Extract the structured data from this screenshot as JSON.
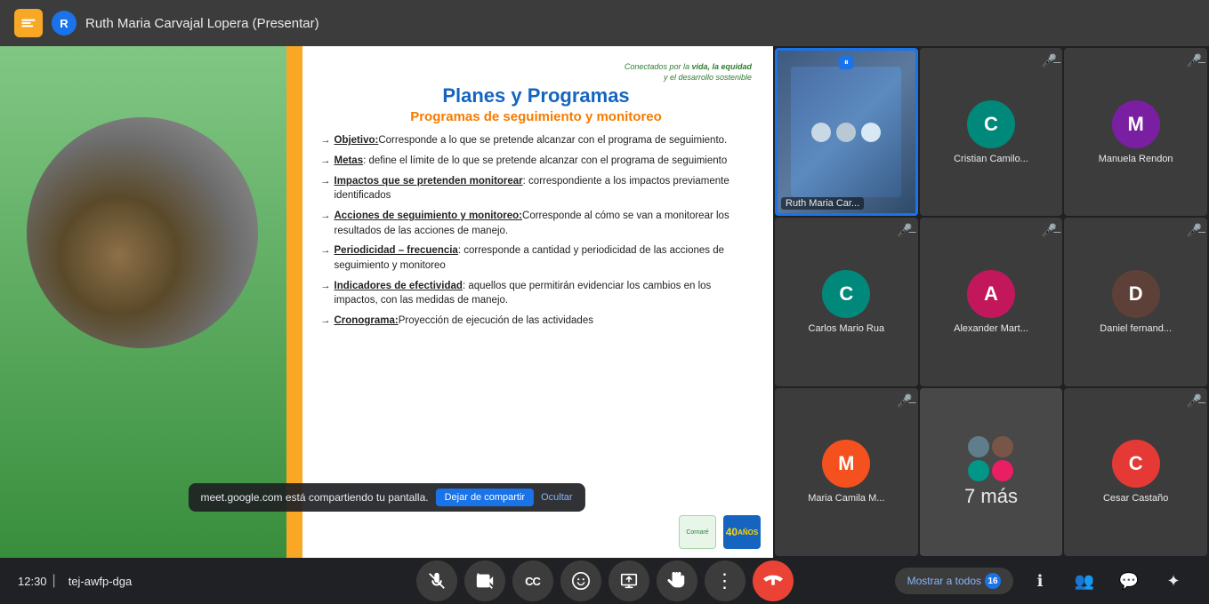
{
  "topbar": {
    "icon_label": "G",
    "avatar_letter": "R",
    "title": "Ruth Maria Carvajal Lopera (Presentar)"
  },
  "slide": {
    "top_text_line1": "Conectados por la",
    "top_text_line2": "vida, la equidad",
    "top_text_line3": "y el desarrollo sostenible",
    "title": "Planes y Programas",
    "subtitle": "Programas de seguimiento y monitoreo",
    "items": [
      {
        "arrow": "→",
        "label": "Objetivo:",
        "text": "Corresponde a lo que se pretende alcanzar con el programa de seguimiento."
      },
      {
        "arrow": "→",
        "label": "Metas",
        "text": ": define el límite de lo que se pretende alcanzar con el programa de seguimiento"
      },
      {
        "arrow": "→",
        "label": "Impactos que se pretenden monitorear",
        "text": ": correspondiente a los impactos previamente identificados"
      },
      {
        "arrow": "→",
        "label": "Acciones de seguimiento y monitoreo:",
        "text": "Corresponde al cómo se van a monitorear los resultados de las acciones de manejo."
      },
      {
        "arrow": "→",
        "label": "Periodicidad – frecuencia",
        "text": ": corresponde a cantidad y periodicidad de las acciones de seguimiento y monitoreo"
      },
      {
        "arrow": "→",
        "label": "Indicadores de efectividad",
        "text": ": aquellos que permitirán evidenciar los cambios en los impactos, con las medidas de manejo."
      },
      {
        "arrow": "→",
        "label": "Cronograma:",
        "text": "Proyección de ejecución de las actividades"
      }
    ]
  },
  "sharing_notification": {
    "text": "meet.google.com está compartiendo tu pantalla.",
    "stop_label": "Dejar de compartir",
    "hide_label": "Ocultar"
  },
  "participants": [
    {
      "id": "ruth",
      "name": "Ruth Maria Car...",
      "type": "video",
      "presenting": true,
      "mic_off": false
    },
    {
      "id": "cristian",
      "name": "Cristian Camilo...",
      "initial": "C",
      "color": "#00897b",
      "mic_off": true
    },
    {
      "id": "manuela",
      "name": "Manuela Rendon",
      "initial": "M",
      "color": "#7b1fa2",
      "mic_off": true
    },
    {
      "id": "carlos",
      "name": "Carlos Mario Rua",
      "initial": "C",
      "color": "#00897b",
      "mic_off": true
    },
    {
      "id": "alexander",
      "name": "Alexander Mart...",
      "initial": "A",
      "color": "#c2185b",
      "mic_off": true
    },
    {
      "id": "daniel",
      "name": "Daniel fernand...",
      "initial": "D",
      "color": "#5d4037",
      "mic_off": true
    },
    {
      "id": "maria",
      "name": "Maria Camila M...",
      "initial": "M",
      "color": "#f4511e",
      "mic_off": true
    },
    {
      "id": "more",
      "name": "7 más",
      "type": "more"
    },
    {
      "id": "cesar",
      "name": "Cesar Castaño",
      "initial": "C",
      "color": "#e53935",
      "mic_off": true
    }
  ],
  "show_all": {
    "label": "Mostrar a todos",
    "count": "16"
  },
  "bottombar": {
    "time": "12:30",
    "meeting_id": "tej-awfp-dga"
  },
  "controls": {
    "mic_label": "🎤",
    "cam_label": "📷",
    "cc_label": "CC",
    "emoji_label": "😊",
    "present_label": "📤",
    "hand_label": "✋",
    "more_label": "⋮",
    "hangup_label": "📞"
  },
  "side_controls": {
    "info_label": "ℹ",
    "people_label": "👥",
    "chat_label": "💬",
    "activities_label": "✦"
  }
}
